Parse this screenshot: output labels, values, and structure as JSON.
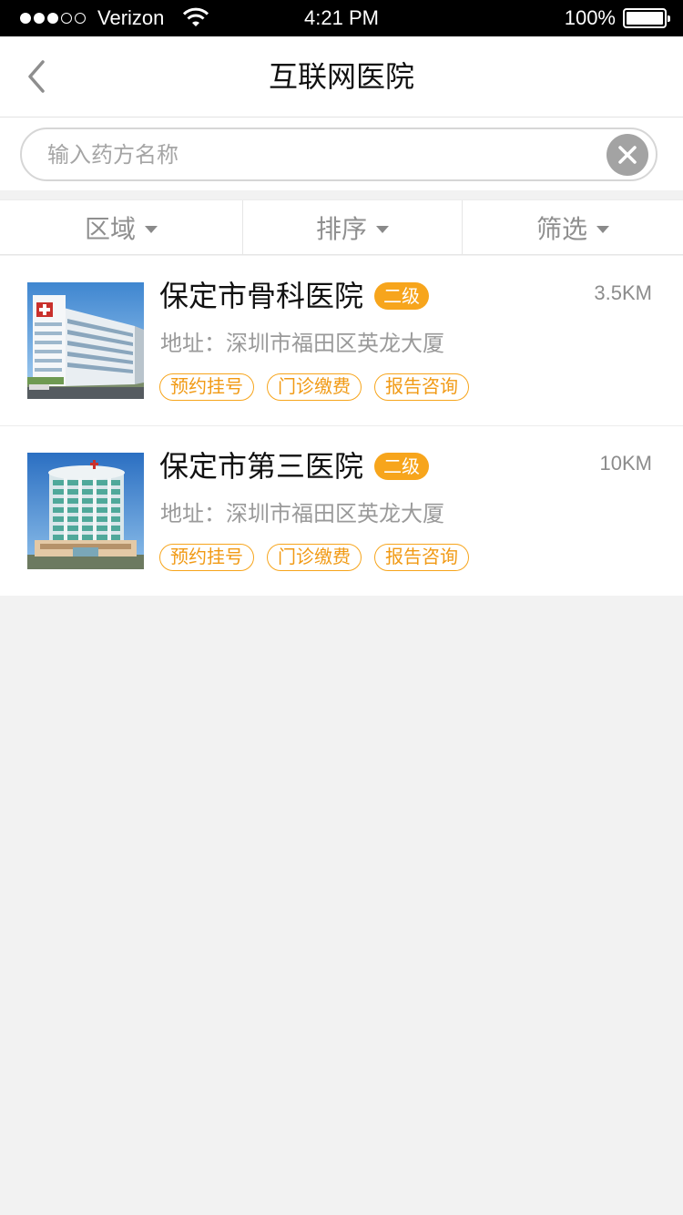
{
  "status_bar": {
    "carrier": "Verizon",
    "time": "4:21 PM",
    "battery": "100%",
    "signal_filled": 3,
    "signal_total": 5
  },
  "nav": {
    "title": "互联网医院",
    "back_icon": "chevron-left-icon"
  },
  "search": {
    "placeholder": "输入药方名称",
    "value": "",
    "clear_icon": "close-circle-icon"
  },
  "filters": [
    {
      "label": "区域",
      "icon": "caret-down-icon"
    },
    {
      "label": "排序",
      "icon": "caret-down-icon"
    },
    {
      "label": "筛选",
      "icon": "caret-down-icon"
    }
  ],
  "hospitals": [
    {
      "name": "保定市骨科医院",
      "level": "二级",
      "distance": "3.5KM",
      "address": "地址：深圳市福田区英龙大厦",
      "tags": [
        "预约挂号",
        "门诊缴费",
        "报告咨询"
      ]
    },
    {
      "name": "保定市第三医院",
      "level": "二级",
      "distance": "10KM",
      "address": "地址：深圳市福田区英龙大厦",
      "tags": [
        "预约挂号",
        "门诊缴费",
        "报告咨询"
      ]
    }
  ],
  "colors": {
    "accent": "#f7a51c",
    "background": "#f2f2f2",
    "muted_text": "#9a9a9a"
  }
}
